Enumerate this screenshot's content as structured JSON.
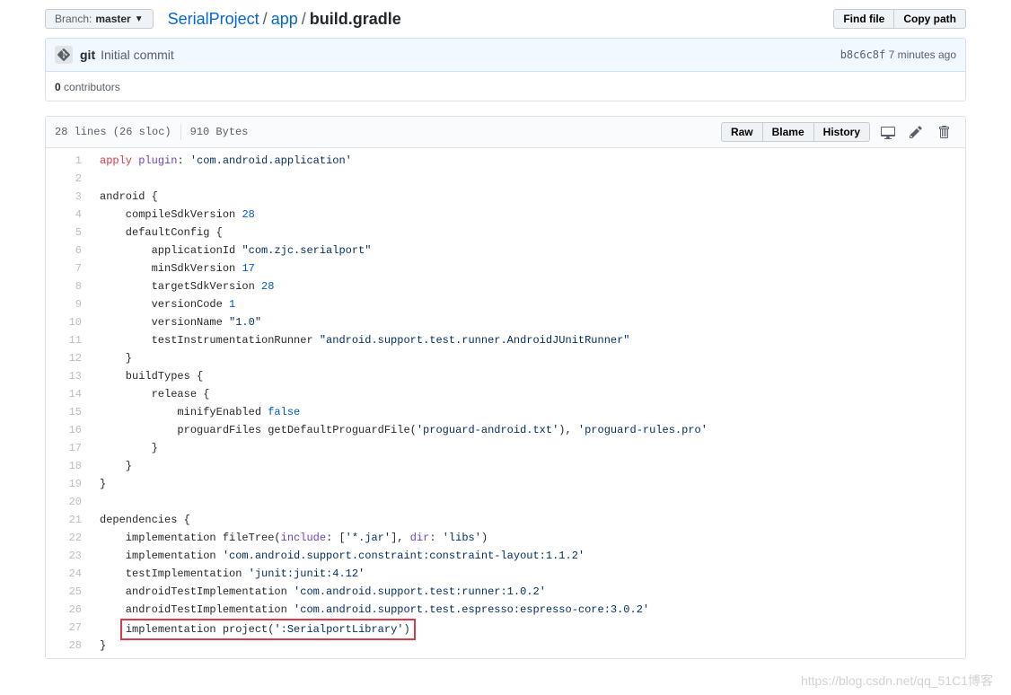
{
  "branch": {
    "label": "Branch:",
    "name": "master"
  },
  "breadcrumb": {
    "root": "SerialProject",
    "mid": "app",
    "current": "build.gradle"
  },
  "nav_buttons": {
    "find_file": "Find file",
    "copy_path": "Copy path"
  },
  "commit": {
    "author": "git",
    "message": "Initial commit",
    "sha": "b8c6c8f",
    "time": "7 minutes ago"
  },
  "contributors": {
    "count": "0",
    "label": " contributors"
  },
  "file_info": {
    "lines": "28 lines (26 sloc)",
    "size": "910 Bytes"
  },
  "file_actions": {
    "raw": "Raw",
    "blame": "Blame",
    "history": "History"
  },
  "code": [
    {
      "n": 1,
      "html": "<span class='pl-k'>apply</span> <span class='pl-e'>plugin</span>: <span class='pl-s'>'com.android.application'</span>"
    },
    {
      "n": 2,
      "html": ""
    },
    {
      "n": 3,
      "html": "android {"
    },
    {
      "n": 4,
      "html": "    compileSdkVersion <span class='pl-c1'>28</span>"
    },
    {
      "n": 5,
      "html": "    defaultConfig {"
    },
    {
      "n": 6,
      "html": "        applicationId <span class='pl-s'>\"com.zjc.serialport\"</span>"
    },
    {
      "n": 7,
      "html": "        minSdkVersion <span class='pl-c1'>17</span>"
    },
    {
      "n": 8,
      "html": "        targetSdkVersion <span class='pl-c1'>28</span>"
    },
    {
      "n": 9,
      "html": "        versionCode <span class='pl-c1'>1</span>"
    },
    {
      "n": 10,
      "html": "        versionName <span class='pl-s'>\"1.0\"</span>"
    },
    {
      "n": 11,
      "html": "        testInstrumentationRunner <span class='pl-s'>\"android.support.test.runner.AndroidJUnitRunner\"</span>"
    },
    {
      "n": 12,
      "html": "    }"
    },
    {
      "n": 13,
      "html": "    buildTypes {"
    },
    {
      "n": 14,
      "html": "        release {"
    },
    {
      "n": 15,
      "html": "            minifyEnabled <span class='pl-c1'>false</span>"
    },
    {
      "n": 16,
      "html": "            proguardFiles getDefaultProguardFile(<span class='pl-s'>'proguard-android.txt'</span>), <span class='pl-s'>'proguard-rules.pro'</span>"
    },
    {
      "n": 17,
      "html": "        }"
    },
    {
      "n": 18,
      "html": "    }"
    },
    {
      "n": 19,
      "html": "}"
    },
    {
      "n": 20,
      "html": ""
    },
    {
      "n": 21,
      "html": "dependencies {"
    },
    {
      "n": 22,
      "html": "    implementation fileTree(<span class='pl-e'>include</span>: [<span class='pl-s'>'*.jar'</span>], <span class='pl-e'>dir</span>: <span class='pl-s'>'libs'</span>)"
    },
    {
      "n": 23,
      "html": "    implementation <span class='pl-s'>'com.android.support.constraint:constraint-layout:1.1.2'</span>"
    },
    {
      "n": 24,
      "html": "    testImplementation <span class='pl-s'>'junit:junit:4.12'</span>"
    },
    {
      "n": 25,
      "html": "    androidTestImplementation <span class='pl-s'>'com.android.support.test:runner:1.0.2'</span>"
    },
    {
      "n": 26,
      "html": "    androidTestImplementation <span class='pl-s'>'com.android.support.test.espresso:espresso-core:3.0.2'</span>"
    },
    {
      "n": 27,
      "html": "    <span class='highlighted'>implementation project(<span class='pl-s'>':SerialportLibrary'</span>)</span>"
    },
    {
      "n": 28,
      "html": "}"
    }
  ],
  "watermark": "https://blog.csdn.net/qq_51C1博客"
}
